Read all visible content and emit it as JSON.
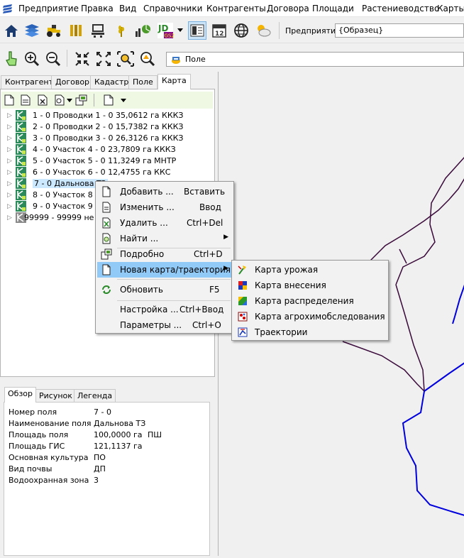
{
  "menubar": {
    "items": [
      "Предприятие",
      "Правка",
      "Вид",
      "Справочники",
      "Контрагенты",
      "Договора",
      "Площади",
      "Растениеводство",
      "Карты"
    ]
  },
  "toolbar1": {
    "enterprise_label": "Предприятие",
    "enterprise_value": "{Образец}",
    "jd_badge": "JD",
    "jd_sub": "GS2",
    "calendar_num": "12"
  },
  "toolbar2": {
    "layer_value": "Поле"
  },
  "tabs": [
    "Контрагент",
    "Договор",
    "Кадастр",
    "Поле",
    "Карта"
  ],
  "tree": {
    "items": [
      "1 - 0 Проводки 1 - 0 35,0612 га КККЗ",
      "2 - 0 Проводки 2 - 0 15,7382 га КККЗ",
      "3 - 0 Проводки 3 - 0 26,3126 га КККЗ",
      "4 - 0 Участок 4 - 0 23,7809 га КККЗ",
      "5 - 0 Участок 5 - 0 11,3249 га МНТР",
      "6 - 0 Участок 6 - 0 12,4755 га ККС",
      "7 - 0 Дальнова ТЗ",
      "8 - 0 Участок 8 -",
      "9 - 0 Участок 9 -",
      "99999 - 99999 не"
    ]
  },
  "bottom_tabs": [
    "Обзор",
    "Рисунок",
    "Легенда"
  ],
  "info": {
    "rows": [
      {
        "label": "Номер поля",
        "value": "7 - 0",
        "unit": ""
      },
      {
        "label": "Наименование поля",
        "value": "Дальнова ТЗ",
        "unit": ""
      },
      {
        "label": "Площадь поля",
        "value": "100,0000 га",
        "unit": "ПШ"
      },
      {
        "label": "Площадь ГИС",
        "value": "121,1137 га",
        "unit": ""
      },
      {
        "label": "Основная культура",
        "value": "ПО",
        "unit": ""
      },
      {
        "label": "Вид почвы",
        "value": "ДП",
        "unit": ""
      },
      {
        "label": "Водоохранная зона",
        "value": "3",
        "unit": ""
      }
    ]
  },
  "context_menu": {
    "items": [
      {
        "label": "Добавить ...",
        "shortcut": "Вставить",
        "icon": "new-doc-icon"
      },
      {
        "label": "Изменить ...",
        "shortcut": "Ввод",
        "icon": "edit-doc-icon"
      },
      {
        "label": "Удалить ...",
        "shortcut": "Ctrl+Del",
        "icon": "delete-doc-icon"
      },
      {
        "label": "Найти ...",
        "shortcut": "",
        "icon": "find-doc-icon",
        "submenu": true
      },
      {
        "label": "Подробно",
        "shortcut": "Ctrl+D",
        "icon": "details-icon"
      },
      {
        "label": "Новая карта/траектория",
        "shortcut": "",
        "icon": "new-map-icon",
        "submenu": true,
        "highlighted": true
      },
      {
        "label": "Обновить",
        "shortcut": "F5",
        "icon": "refresh-icon"
      },
      {
        "label": "Настройка ...",
        "shortcut": "Ctrl+Ввод",
        "icon": ""
      },
      {
        "label": "Параметры ...",
        "shortcut": "Ctrl+O",
        "icon": ""
      }
    ]
  },
  "submenu": {
    "items": [
      {
        "label": "Карта урожая",
        "icon": "harvest-map-icon"
      },
      {
        "label": "Карта внесения",
        "icon": "application-map-icon"
      },
      {
        "label": "Карта распределения",
        "icon": "distribution-map-icon"
      },
      {
        "label": "Карта агрохимобследования",
        "icon": "agrochem-map-icon"
      },
      {
        "label": "Траектории",
        "icon": "trajectory-icon"
      }
    ]
  },
  "colors": {
    "selection": "#cce8ff",
    "menu_highlight": "#91c9f7",
    "map_boundary": "#3a0a3a",
    "map_blue": "#0000dd"
  }
}
